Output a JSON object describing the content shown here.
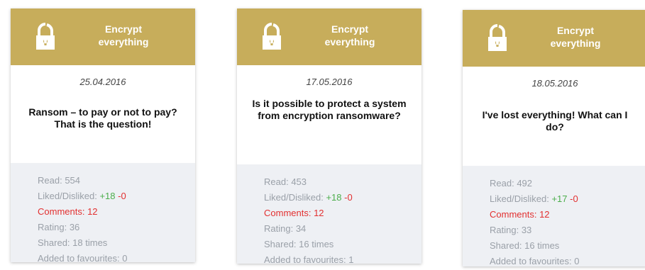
{
  "banner": {
    "title_line1": "Encrypt",
    "title_line2": "everything",
    "icon": "lock-icon",
    "color": "#c7ad5b"
  },
  "labels": {
    "read": "Read: ",
    "liked": "Liked/Disliked: ",
    "comments": "Comments: ",
    "rating": "Rating: ",
    "shared": "Shared: ",
    "shared_suffix": " times",
    "favourites": "Added to favourites: "
  },
  "cards": [
    {
      "date": "25.04.2016",
      "title": "Ransom – to pay or not to pay? That is the question!",
      "read": "554",
      "liked": "+18",
      "disliked": "-0",
      "comments": "12",
      "rating": "36",
      "shared": "18",
      "favourites": "0"
    },
    {
      "date": "17.05.2016",
      "title": "Is it possible to protect a system from encryption ransomware?",
      "read": "453",
      "liked": "+18",
      "disliked": "-0",
      "comments": "12",
      "rating": "34",
      "shared": "16",
      "favourites": "1"
    },
    {
      "date": "18.05.2016",
      "title": "I've lost everything! What can I do?",
      "read": "492",
      "liked": "+17",
      "disliked": "-0",
      "comments": "12",
      "rating": "33",
      "shared": "16",
      "favourites": "0"
    }
  ]
}
